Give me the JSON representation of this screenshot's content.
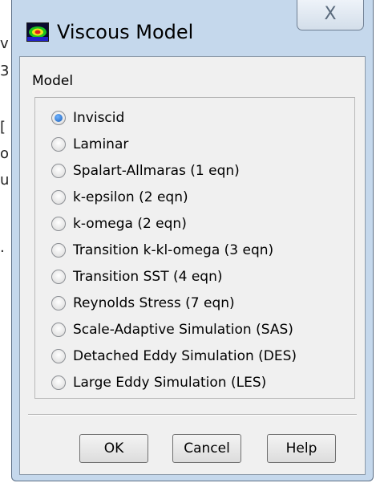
{
  "background": {
    "fragments": [
      "v",
      "3",
      "[",
      "o",
      "u",
      "·"
    ]
  },
  "window": {
    "title": "Viscous Model",
    "close_glyph": "X"
  },
  "model_group": {
    "label": "Model",
    "selected_index": 0,
    "options": [
      {
        "label": "Inviscid"
      },
      {
        "label": "Laminar"
      },
      {
        "label": "Spalart-Allmaras (1 eqn)"
      },
      {
        "label": "k-epsilon (2 eqn)"
      },
      {
        "label": "k-omega (2 eqn)"
      },
      {
        "label": "Transition k-kl-omega (3 eqn)"
      },
      {
        "label": "Transition SST (4 eqn)"
      },
      {
        "label": "Reynolds Stress (7 eqn)"
      },
      {
        "label": "Scale-Adaptive Simulation (SAS)"
      },
      {
        "label": "Detached Eddy Simulation (DES)"
      },
      {
        "label": "Large Eddy Simulation (LES)"
      }
    ]
  },
  "buttons": {
    "ok": "OK",
    "cancel": "Cancel",
    "help": "Help"
  }
}
